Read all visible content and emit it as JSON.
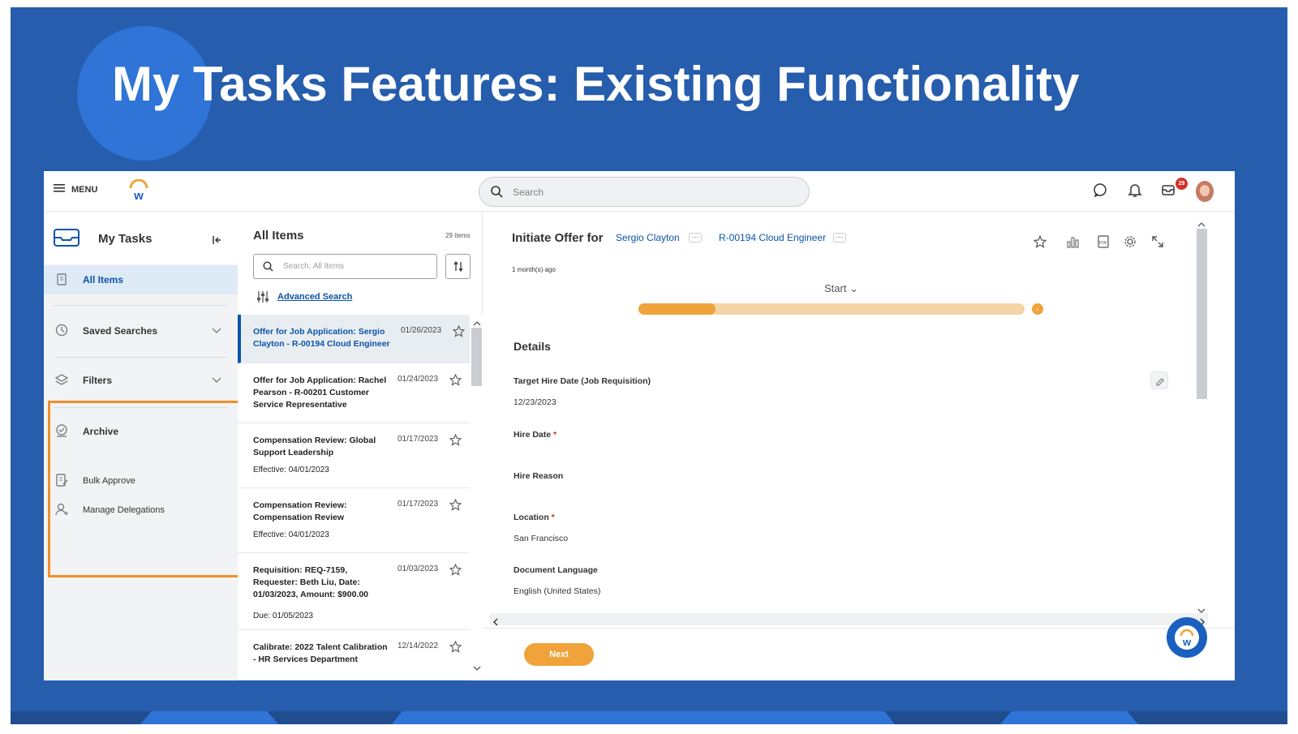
{
  "slide": {
    "title": "My Tasks Features: Existing Functionality"
  },
  "topbar": {
    "menu_label": "MENU",
    "search_placeholder": "Search",
    "inbox_badge": "29"
  },
  "left_panel": {
    "title": "My Tasks",
    "items": [
      {
        "label": "All Items",
        "icon": "clipboard-icon"
      },
      {
        "label": "Saved Searches",
        "icon": "clock-icon"
      },
      {
        "label": "Filters",
        "icon": "layers-icon"
      },
      {
        "label": "Archive",
        "icon": "check-circle-icon"
      },
      {
        "label": "Bulk Approve",
        "icon": "document-edit-icon"
      },
      {
        "label": "Manage Delegations",
        "icon": "person-delegate-icon"
      }
    ]
  },
  "middle_panel": {
    "title": "All Items",
    "count": "29 Items",
    "search_placeholder": "Search: All Items",
    "advanced_search": "Advanced Search",
    "tasks": [
      {
        "title": "Offer for Job Application: Sergio Clayton - R-00194 Cloud Engineer",
        "date": "01/26/2023",
        "extra": ""
      },
      {
        "title": "Offer for Job Application: Rachel Pearson - R-00201 Customer Service Representative",
        "date": "01/24/2023",
        "extra": ""
      },
      {
        "title": "Compensation Review: Global Support Leadership",
        "date": "01/17/2023",
        "extra": "Effective: 04/01/2023"
      },
      {
        "title": "Compensation Review: Compensation Review",
        "date": "01/17/2023",
        "extra": "Effective: 04/01/2023"
      },
      {
        "title": "Requisition: REQ-7159, Requester: Beth Liu, Date: 01/03/2023, Amount: $900.00",
        "date": "01/03/2023",
        "extra": "Due: 01/05/2023"
      },
      {
        "title": "Calibrate: 2022 Talent Calibration - HR Services Department",
        "date": "12/14/2022",
        "extra": ""
      }
    ]
  },
  "detail": {
    "title": "Initiate Offer for",
    "candidate_link": "Sergio Clayton",
    "requisition_link": "R-00194 Cloud Engineer",
    "dots": "···",
    "age": "1 month(s) ago",
    "stage": "Start ⌄",
    "progress_fraction": 0.2,
    "details_heading": "Details",
    "fields": [
      {
        "label": "Target Hire Date (Job Requisition)",
        "value": "12/23/2023",
        "required": false
      },
      {
        "label": "Hire Date",
        "value": "",
        "required": true
      },
      {
        "label": "Hire Reason",
        "value": "",
        "required": false
      },
      {
        "label": "Location",
        "value": "San Francisco",
        "required": true
      },
      {
        "label": "Document Language",
        "value": "English (United States)",
        "required": false
      }
    ],
    "next_label": "Next",
    "required_mark": "*"
  },
  "colors": {
    "slide_bg": "#265dad",
    "accent_orange": "#f0a33a",
    "link_blue": "#0c54a8",
    "highlight_box": "#f0902a"
  }
}
